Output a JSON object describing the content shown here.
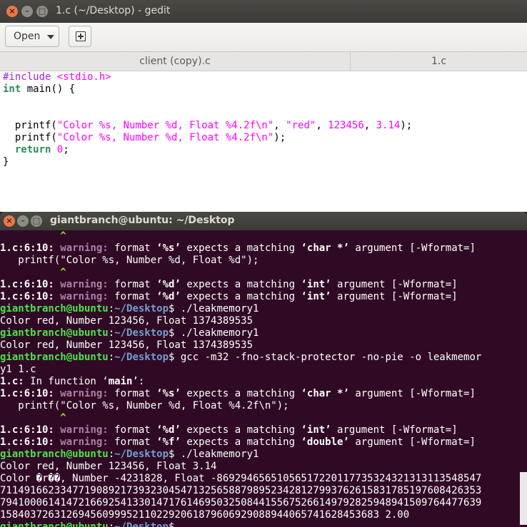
{
  "gedit": {
    "title": "1.c (~/Desktop) - gedit",
    "open_label": "Open",
    "tabs": [
      "client (copy).c",
      "1.c"
    ]
  },
  "code": {
    "l1_pre": "#include ",
    "l1_hdr": "<stdio.h>",
    "l2_kw": "int",
    "l2_rest": " main() {",
    "l5_a": "  printf(",
    "l5_str": "\"Color %s, Number %d, Float %4.2f\\n\"",
    "l5_c": ", ",
    "l5_red": "\"red\"",
    "l5_d": ", ",
    "l5_n1": "123456",
    "l5_e": ", ",
    "l5_n2": "3.14",
    "l5_f": ");",
    "l6_a": "  printf(",
    "l6_str": "\"Color %s, Number %d, Float %4.2f\\n\"",
    "l6_f": ");",
    "l7_sp": "  ",
    "l7_kw": "return",
    "l7_sp2": " ",
    "l7_num": "0",
    "l7_end": ";",
    "l8": "}"
  },
  "terminal": {
    "title": "giantbranch@ubuntu: ~/Desktop",
    "caret": "^",
    "loc": "1.c:6:10: ",
    "warning": "warning: ",
    "fmt": "format ",
    "expects": " expects a matching ",
    "argument": " argument [-Wformat=]",
    "q_s": "‘%s’",
    "q_d": "‘%d’",
    "q_f": "‘%f’",
    "t_charp": "‘char *’",
    "t_int": "‘int’",
    "t_double": "‘double’",
    "src1": "   printf(\"Color %s, Number %d, Float %d\");",
    "src2": "   printf(\"Color %s, Number %d, Float %4.2f\\n\");",
    "user": "giantbranch@ubuntu",
    "colon": ":",
    "path": "~/Desktop",
    "dollar": "$ ",
    "cmd_leak": "./leakmemory1",
    "out1": "Color red, Number 123456, Float 1374389535",
    "cmd_gcc": "gcc -m32 -fno-stack-protector -no-pie -o leakmemor",
    "cmd_gcc2": "y1 1.c",
    "infn_file": "1.c:",
    "infn_text": " In function ‘",
    "infn_main": "main",
    "infn_end": "’:",
    "out2": "Color red, Number 123456, Float 3.14",
    "out3a": "Color �r��, Number -4231828, Float -8692946565105651722011773532432131311354854",
    "out3a2": "7",
    "out3b": "7114916623347719089217393230454713256588798952342812799376261583178519760842635",
    "out3b2": "3",
    "out3c": "7941000614147216692541330147176146950325084415567526614979282594894150976447763",
    "out3c2": "9",
    "out3d": "158403726312694560999521102292061879606929088944065741628453683 2.00"
  }
}
